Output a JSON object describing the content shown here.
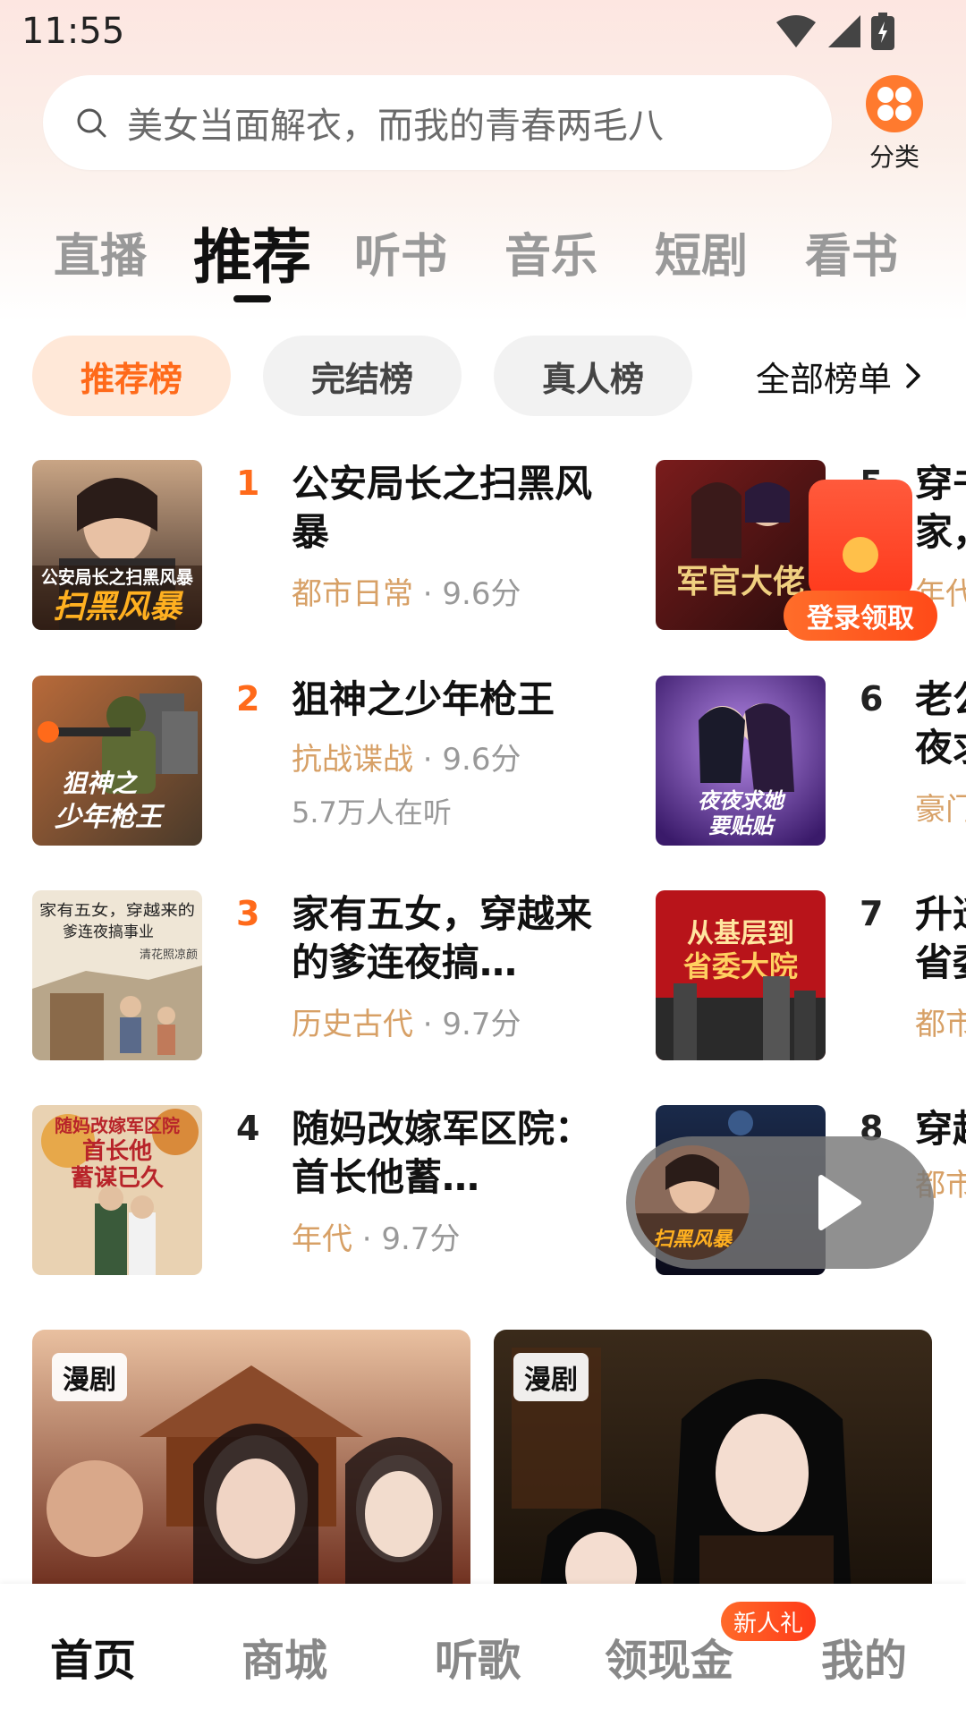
{
  "status_bar": {
    "time": "11:55"
  },
  "search": {
    "placeholder_text": "美女当面解衣，而我的青春两毛八"
  },
  "category": {
    "label": "分类"
  },
  "main_tabs": [
    "直播",
    "推荐",
    "听书",
    "音乐",
    "短剧",
    "看书"
  ],
  "main_tab_active": "推荐",
  "sub_tabs": [
    "推荐榜",
    "完结榜",
    "真人榜"
  ],
  "sub_tab_active": "推荐榜",
  "all_list_label": "全部榜单",
  "books": [
    {
      "rank": "1",
      "title": "公安局长之扫黑风暴",
      "genre": "都市日常",
      "score": " · 9.6分",
      "listeners": ""
    },
    {
      "rank": "2",
      "title": "狙神之少年枪王",
      "genre": "抗战谍战",
      "score": " · 9.6分",
      "listeners": "5.7万人在听"
    },
    {
      "rank": "3",
      "title": "家有五女，穿越来的爹连夜搞…",
      "genre": "历史古代",
      "score": " · 9.7分",
      "listeners": ""
    },
    {
      "rank": "4",
      "title": "随妈改嫁军区院：首长他蓄…",
      "genre": "年代",
      "score": " · 9.7分",
      "listeners": ""
    }
  ],
  "books_right": [
    {
      "rank": "5",
      "title": "穿书\n家，",
      "meta": "年代"
    },
    {
      "rank": "6",
      "title": "老公\n夜求",
      "meta": "豪门"
    },
    {
      "rank": "7",
      "title": "升迁\n省委",
      "meta": "都市"
    },
    {
      "rank": "8",
      "title": "穿越",
      "meta": "都市"
    }
  ],
  "cover_texts": {
    "b1": "公安局长之扫黑风暴",
    "b2": "狙神之少年枪王",
    "b3": "家有五女，穿越来的爹连夜搞事业",
    "b3_author": "清花照凉颜",
    "b4": "随妈改嫁军区院首长他蓄谋已久",
    "r5": "军官大佬",
    "r6": "夜夜求她要贴贴",
    "r7": "从基层到省委大院"
  },
  "red_packet": {
    "label": "登录领取"
  },
  "mini_player": {
    "cover_text": "公安局长之扫黑风暴"
  },
  "drama_cards": [
    {
      "badge": "漫剧"
    },
    {
      "badge": "漫剧"
    }
  ],
  "bottom_nav": {
    "items": [
      "首页",
      "商城",
      "听歌",
      "领现金",
      "我的"
    ],
    "active": "首页",
    "badge": "新人礼"
  },
  "colors": {
    "accent": "#ff6a1a",
    "chip_active_bg": "#ffe8d8",
    "genre": "#d7a066",
    "red_packet": "#ff4a18"
  }
}
